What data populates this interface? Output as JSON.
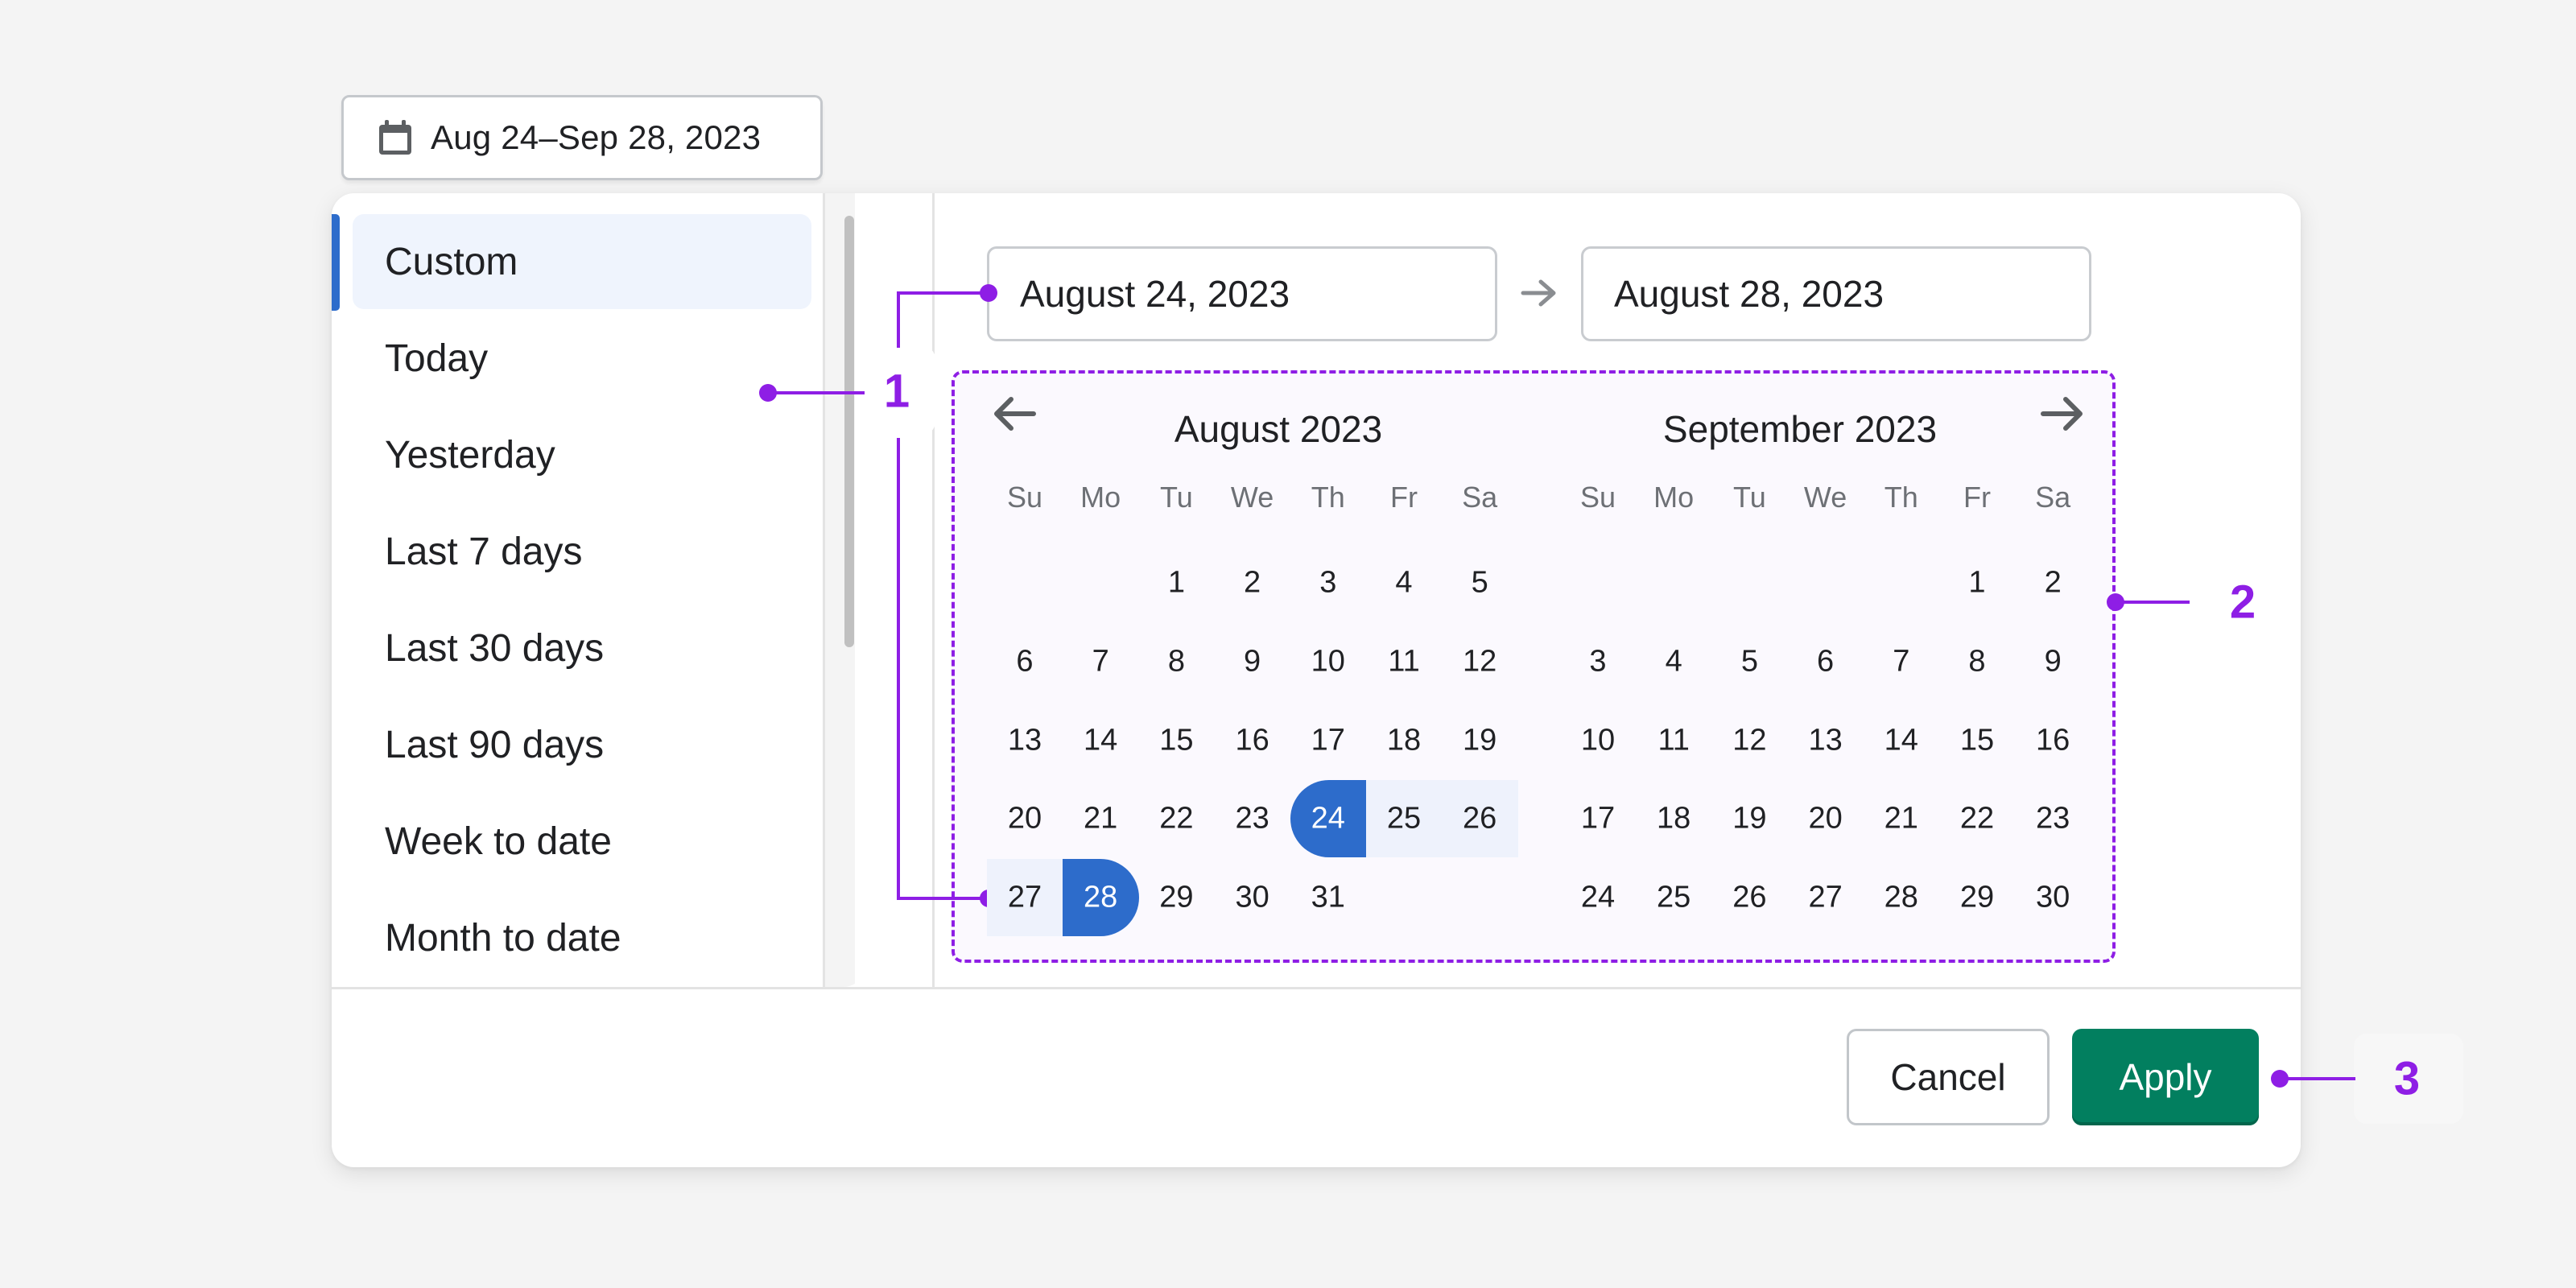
{
  "trigger": {
    "icon": "calendar-icon",
    "label": "Aug 24–Sep 28, 2023"
  },
  "sidebar": {
    "items": [
      {
        "label": "Custom",
        "active": true
      },
      {
        "label": "Today"
      },
      {
        "label": "Yesterday"
      },
      {
        "label": "Last 7 days"
      },
      {
        "label": "Last 30 days"
      },
      {
        "label": "Last 90 days"
      },
      {
        "label": "Week to date"
      },
      {
        "label": "Month to date"
      }
    ]
  },
  "range": {
    "start_value": "August 24, 2023",
    "end_value": "August 28, 2023",
    "separator_icon": "arrow-right-icon"
  },
  "calendar": {
    "prev_icon": "arrow-left-icon",
    "next_icon": "arrow-right-icon",
    "weekdays": [
      "Su",
      "Mo",
      "Tu",
      "We",
      "Th",
      "Fr",
      "Sa"
    ],
    "months": [
      {
        "title": "August 2023",
        "first_weekday": 2,
        "days_in_month": 31,
        "range_start": 24,
        "range_end": 28
      },
      {
        "title": "September 2023",
        "first_weekday": 5,
        "days_in_month": 30
      }
    ],
    "colors": {
      "selected": "#2d6ccb",
      "in_range": "#eef2fc"
    }
  },
  "footer": {
    "cancel_label": "Cancel",
    "apply_label": "Apply",
    "apply_color": "#027f5f"
  },
  "annotations": [
    {
      "number": "1"
    },
    {
      "number": "2"
    },
    {
      "number": "3"
    }
  ],
  "annotation_color": "#8e1ee5"
}
